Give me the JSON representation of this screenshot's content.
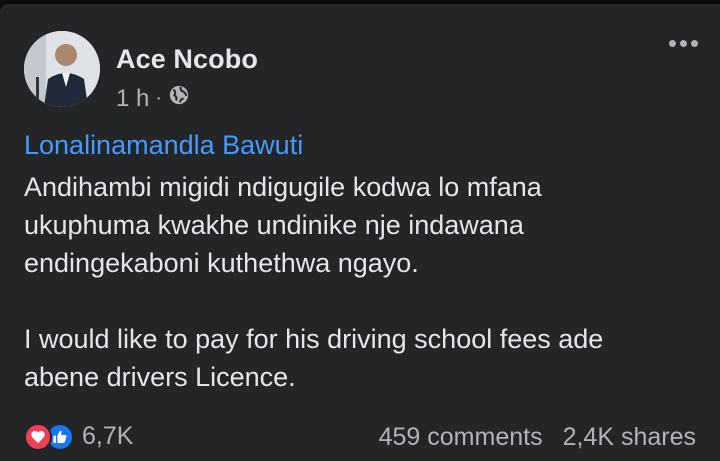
{
  "post": {
    "author": "Ace Ncobo",
    "time": "1 h",
    "separator": "·",
    "privacy_icon": "globe-icon",
    "more_icon": "more-options-icon",
    "mention": "Lonalinamandla Bawuti",
    "text": "Andihambi migidi ndigugile kodwa lo mfana\nukuphuma kwakhe undinike nje indawana\nendingekaboni kuthethwa ngayo.\n\nI would like to pay for his driving school fees ade\nabene drivers Licence."
  },
  "footer": {
    "reactions": [
      "love-icon",
      "like-icon"
    ],
    "reaction_count": "6,7K",
    "comments": "459 comments",
    "shares": "2,4K shares"
  },
  "colors": {
    "card_bg": "#242526",
    "text": "#e4e6eb",
    "secondary": "#b0b3b8",
    "link": "#4599ff",
    "love": "#f33e58",
    "like": "#1877f2"
  }
}
